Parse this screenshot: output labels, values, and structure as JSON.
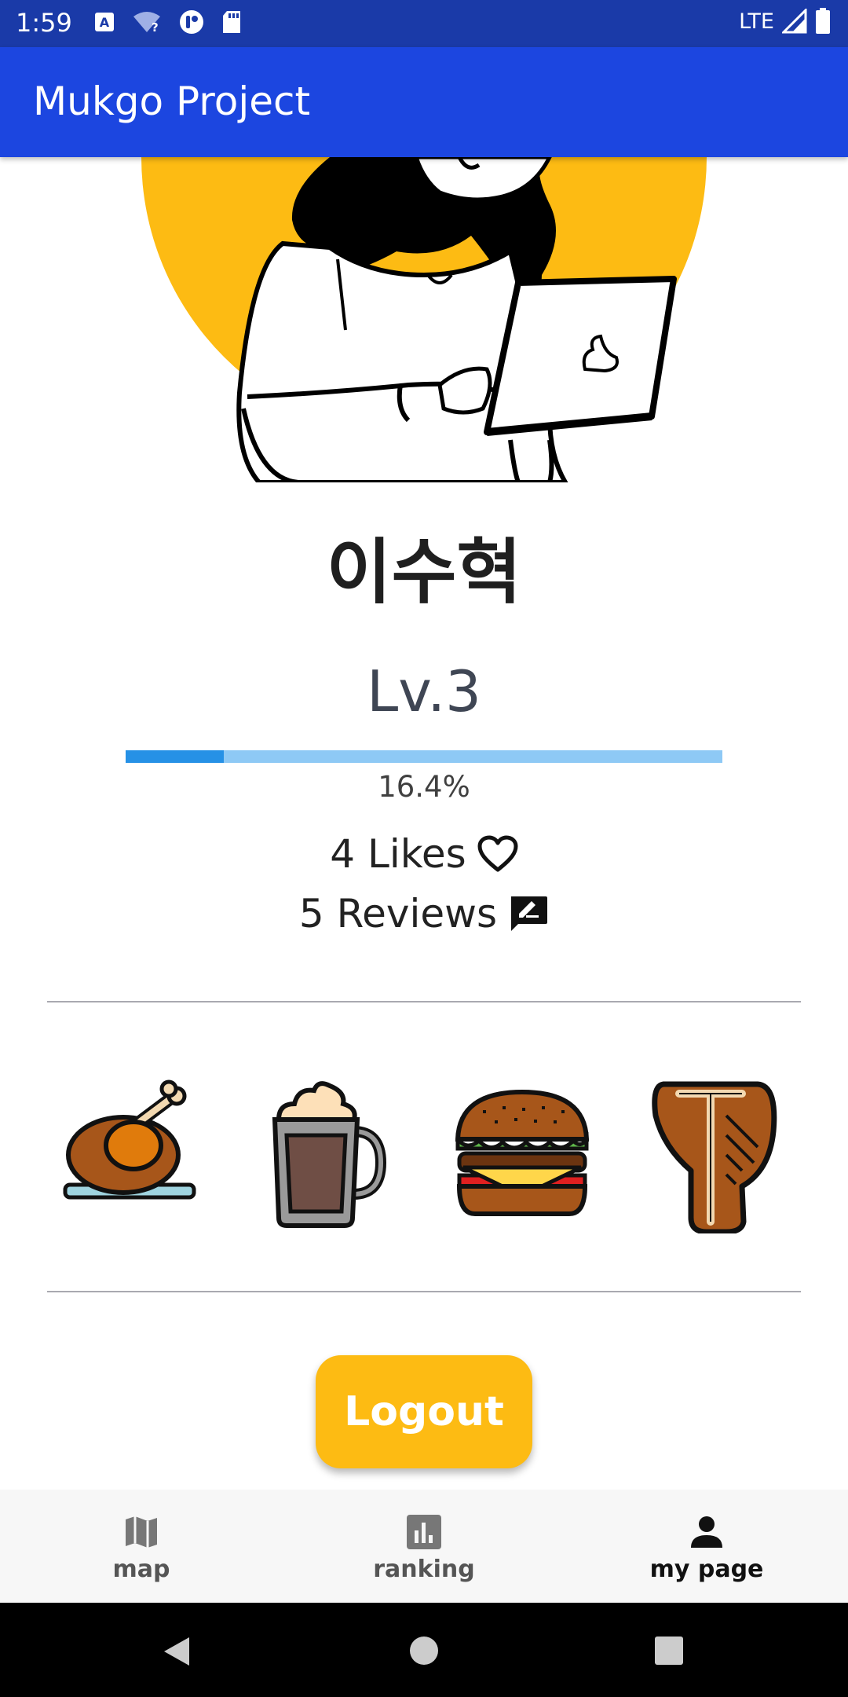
{
  "status_bar": {
    "time": "1:59",
    "network": "LTE"
  },
  "app_bar": {
    "title": "Mukgo Project"
  },
  "profile": {
    "name": "이수혁",
    "level": "Lv.3",
    "progress_percent": 16.4,
    "progress_text": "16.4%",
    "likes_text": "4 Likes",
    "reviews_text": "5 Reviews"
  },
  "badges": [
    "roast-chicken-icon",
    "hot-chocolate-icon",
    "burger-icon",
    "t-bone-steak-icon"
  ],
  "logout_label": "Logout",
  "nav": {
    "items": [
      {
        "label": "map",
        "icon": "map-icon"
      },
      {
        "label": "ranking",
        "icon": "bar-chart-icon"
      },
      {
        "label": "my page",
        "icon": "person-icon",
        "active": true
      }
    ]
  },
  "colors": {
    "status_bar": "#1a3aa8",
    "app_bar": "#1c46e0",
    "accent_yellow": "#fdbb13",
    "progress_fill": "#2691e6",
    "progress_track": "#8ec9f5"
  }
}
